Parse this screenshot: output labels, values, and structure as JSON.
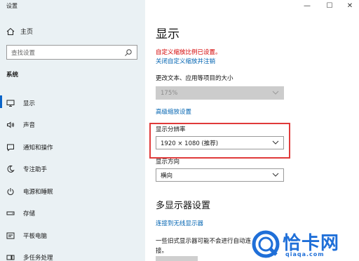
{
  "window": {
    "title": "设置",
    "minimize": "—",
    "maximize": "☐",
    "close": "✕"
  },
  "sidebar": {
    "home": "主页",
    "search_placeholder": "查找设置",
    "section": "系统",
    "items": [
      {
        "label": "显示",
        "icon": "monitor-icon",
        "active": true
      },
      {
        "label": "声音",
        "icon": "speaker-icon"
      },
      {
        "label": "通知和操作",
        "icon": "notification-icon"
      },
      {
        "label": "专注助手",
        "icon": "moon-icon"
      },
      {
        "label": "电源和睡眠",
        "icon": "power-icon"
      },
      {
        "label": "存储",
        "icon": "storage-icon"
      },
      {
        "label": "平板电脑",
        "icon": "tablet-icon"
      },
      {
        "label": "多任务处理",
        "icon": "multitask-icon"
      }
    ]
  },
  "main": {
    "title": "显示",
    "warning": "自定义缩放比例已设置。",
    "turn_off_scaling_link": "关闭自定义缩放并注销",
    "scale_label": "更改文本、应用等项目的大小",
    "scale_value": "175%",
    "advanced_scaling_link": "高级缩放设置",
    "resolution_label": "显示分辨率",
    "resolution_value": "1920 × 1080 (推荐)",
    "orientation_label": "显示方向",
    "orientation_value": "横向",
    "multi_display_heading": "多显示器设置",
    "wireless_link": "连接到无线显示器",
    "note_text": "一些旧式显示器可能不会进行自动连接。"
  },
  "watermark": {
    "brand": "恰卡网",
    "url": "qiaqa.com",
    "color": "#1f6fd8"
  },
  "colors": {
    "accent": "#0063b1",
    "warning": "#d40000",
    "highlight": "#e03a3a",
    "sidebar_bg": "#eaf1f4"
  }
}
